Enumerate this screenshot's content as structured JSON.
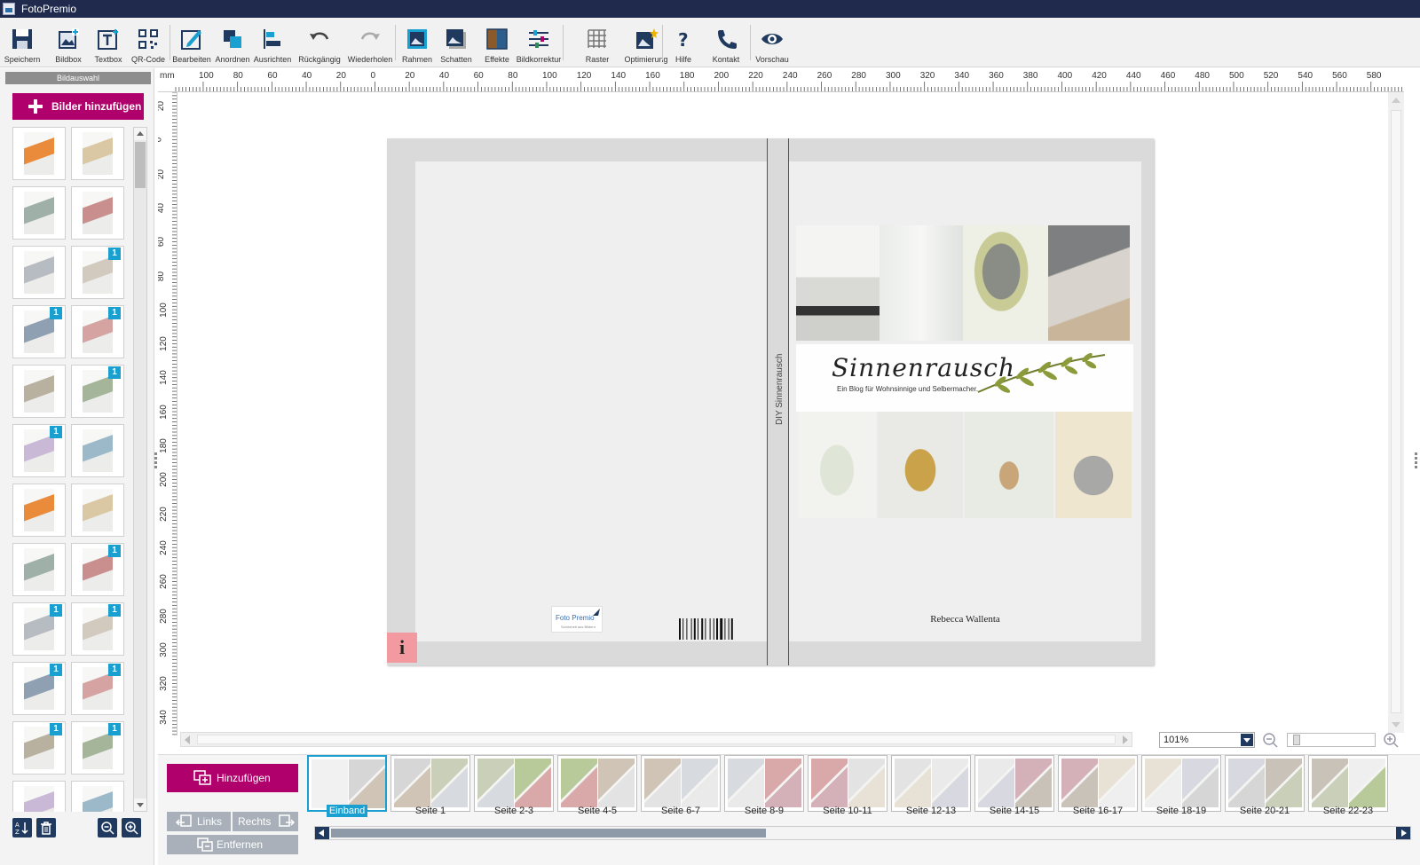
{
  "window": {
    "title": "FotoPremio"
  },
  "colors": {
    "titlebar": "#1f2a4d",
    "accent": "#b0006b",
    "highlight": "#1aa0d0",
    "info": "#f39aa0"
  },
  "toolbar": {
    "items": [
      {
        "label": "Speichern",
        "icon": "save-icon"
      },
      {
        "label": "Bildbox",
        "icon": "image-box-icon"
      },
      {
        "label": "Textbox",
        "icon": "text-box-icon"
      },
      {
        "label": "QR-Code",
        "icon": "qr-code-icon"
      },
      {
        "label": "Bearbeiten",
        "icon": "edit-icon"
      },
      {
        "label": "Anordnen",
        "icon": "arrange-icon"
      },
      {
        "label": "Ausrichten",
        "icon": "align-icon"
      },
      {
        "label": "Rückgängig",
        "icon": "undo-icon"
      },
      {
        "label": "Wiederholen",
        "icon": "redo-icon"
      },
      {
        "label": "Rahmen",
        "icon": "frame-icon"
      },
      {
        "label": "Schatten",
        "icon": "shadow-icon"
      },
      {
        "label": "Effekte",
        "icon": "effects-icon"
      },
      {
        "label": "Bildkorrektur",
        "icon": "image-correction-icon"
      },
      {
        "label": "Raster",
        "icon": "grid-icon"
      },
      {
        "label": "Optimierung",
        "icon": "optimize-icon"
      },
      {
        "label": "Hilfe",
        "icon": "help-icon"
      },
      {
        "label": "Kontakt",
        "icon": "phone-icon"
      },
      {
        "label": "Vorschau",
        "icon": "eye-icon"
      }
    ]
  },
  "left_panel": {
    "header": "Bildauswahl",
    "add_images_label": "Bilder hinzufügen",
    "badge_text": "1",
    "thumbnails_badged": [
      false,
      false,
      false,
      false,
      false,
      true,
      true,
      true,
      false,
      true,
      true,
      false,
      false,
      false,
      false,
      true,
      true,
      true,
      true,
      true,
      true,
      true,
      false,
      false
    ]
  },
  "ruler": {
    "h_unit": "mm",
    "h_labels": [
      "100",
      "80",
      "60",
      "40",
      "20",
      "0",
      "20",
      "40",
      "60",
      "80",
      "100",
      "120",
      "140",
      "160",
      "180",
      "200",
      "220",
      "240",
      "260",
      "280",
      "300",
      "320",
      "340",
      "360",
      "380",
      "400",
      "420",
      "440",
      "460",
      "480",
      "500",
      "520",
      "540",
      "560",
      "580"
    ],
    "v_labels": [
      "20",
      "0",
      "20",
      "40",
      "60",
      "80",
      "100",
      "120",
      "140",
      "160",
      "180",
      "200",
      "220",
      "240",
      "260",
      "280",
      "300",
      "320",
      "340"
    ]
  },
  "cover": {
    "spine_text": "DIY Sinnenrausch",
    "logo_text": "Foto Premio",
    "logo_subtext": "Schönheit aus Bildern",
    "info_label": "i",
    "title_script": "Sinnenrausch",
    "tagline": "Ein Blog für Wohnsinnige und Selbermacher.",
    "author": "Rebecca Wallenta"
  },
  "zoom": {
    "value": "101%"
  },
  "pages": {
    "add_label": "Hinzufügen",
    "left_label": "Links",
    "right_label": "Rechts",
    "remove_label": "Entfernen",
    "items": [
      "Einband",
      "Seite 1",
      "Seite 2-3",
      "Seite 4-5",
      "Seite 6-7",
      "Seite 8-9",
      "Seite 10-11",
      "Seite 12-13",
      "Seite 14-15",
      "Seite 16-17",
      "Seite 18-19",
      "Seite 20-21",
      "Seite 22-23"
    ],
    "selected": 0
  }
}
